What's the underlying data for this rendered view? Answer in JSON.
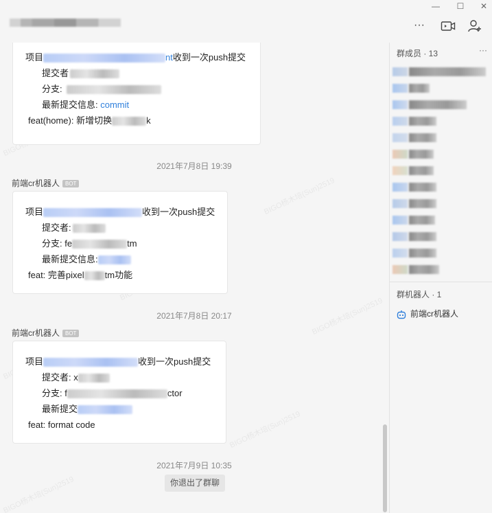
{
  "window": {
    "minimize_glyph": "—",
    "maximize_glyph": "☐",
    "close_glyph": "✕",
    "toolbar_more_glyph": "···"
  },
  "messages": [
    {
      "project_prefix": "项目",
      "project_link_tail": "nt",
      "project_suffix": "收到一次push提交",
      "submitter_label": "提交者",
      "branch_label": "分支:",
      "msg_label": "最新提交信息:",
      "msg_link": "commit",
      "feat_text_a": "feat(home): 新增切换",
      "feat_text_b": "k"
    },
    {
      "timestamp": "2021年7月8日 19:39",
      "sender": "前端cr机器人",
      "badge": "BOT",
      "project_prefix": "项目",
      "project_suffix": "收到一次push提交",
      "submitter_label": "提交者:",
      "branch_label": "分支:",
      "branch_head": "fe",
      "branch_tail": "tm",
      "msg_label": "最新提交信息:",
      "feat_text_a": "feat: 完善pixel",
      "feat_text_b": "tm功能"
    },
    {
      "timestamp": "2021年7月8日 20:17",
      "sender": "前端cr机器人",
      "badge": "BOT",
      "project_prefix": "项目",
      "project_suffix": "收到一次push提交",
      "submitter_label": "提交者:",
      "submitter_head": "x",
      "branch_label": "分支:",
      "branch_head": "f",
      "branch_tail": "ctor",
      "msg_label": "最新提交",
      "feat_text": "feat: format code"
    }
  ],
  "final": {
    "timestamp": "2021年7月9日 10:35",
    "notice": "你退出了群聊"
  },
  "watermark": "BIGO杨木培(Sun)2519",
  "sidebar": {
    "members_title": "群成员 · 13",
    "more_glyph": "···",
    "robots_title": "群机器人 · 1",
    "robot_name": "前端cr机器人"
  }
}
